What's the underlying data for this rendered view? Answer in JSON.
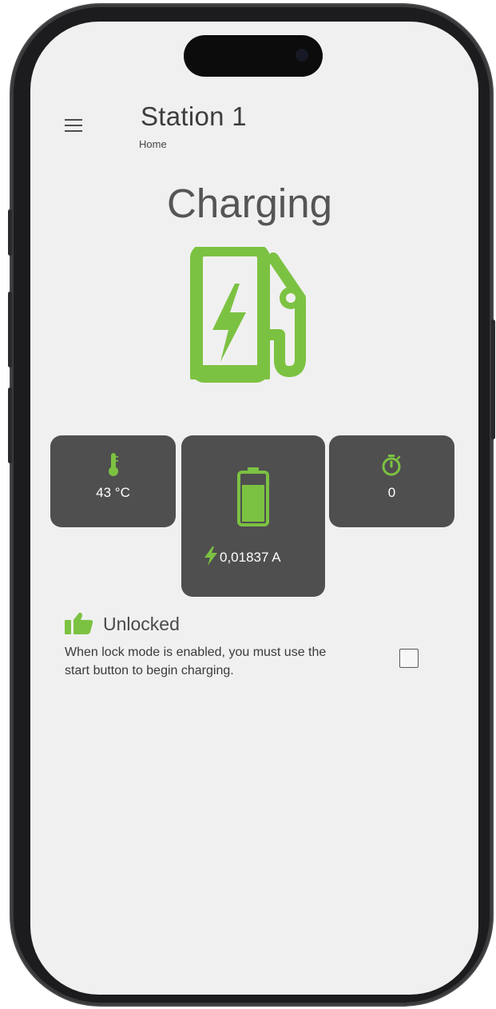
{
  "header": {
    "title": "Station 1",
    "breadcrumb": "Home"
  },
  "status": {
    "label": "Charging"
  },
  "metrics": {
    "temperature": "43 °C",
    "current": "0,01837 A",
    "timer": "0"
  },
  "lock": {
    "label": "Unlocked",
    "description": "When lock mode is enabled, you must use the start button to begin charging.",
    "checked": false
  },
  "icons": {
    "menu": "hamburger-menu-icon",
    "station": "ev-charging-station-icon",
    "temperature": "thermometer-icon",
    "battery": "battery-icon",
    "current": "lightning-bolt-icon",
    "timer": "stopwatch-icon",
    "lock_status": "thumbs-up-icon"
  },
  "colors": {
    "accent": "#7cc242",
    "card_background": "#4f4f4f",
    "screen_background": "#f0f0f0",
    "text": "#3d3d3d"
  }
}
